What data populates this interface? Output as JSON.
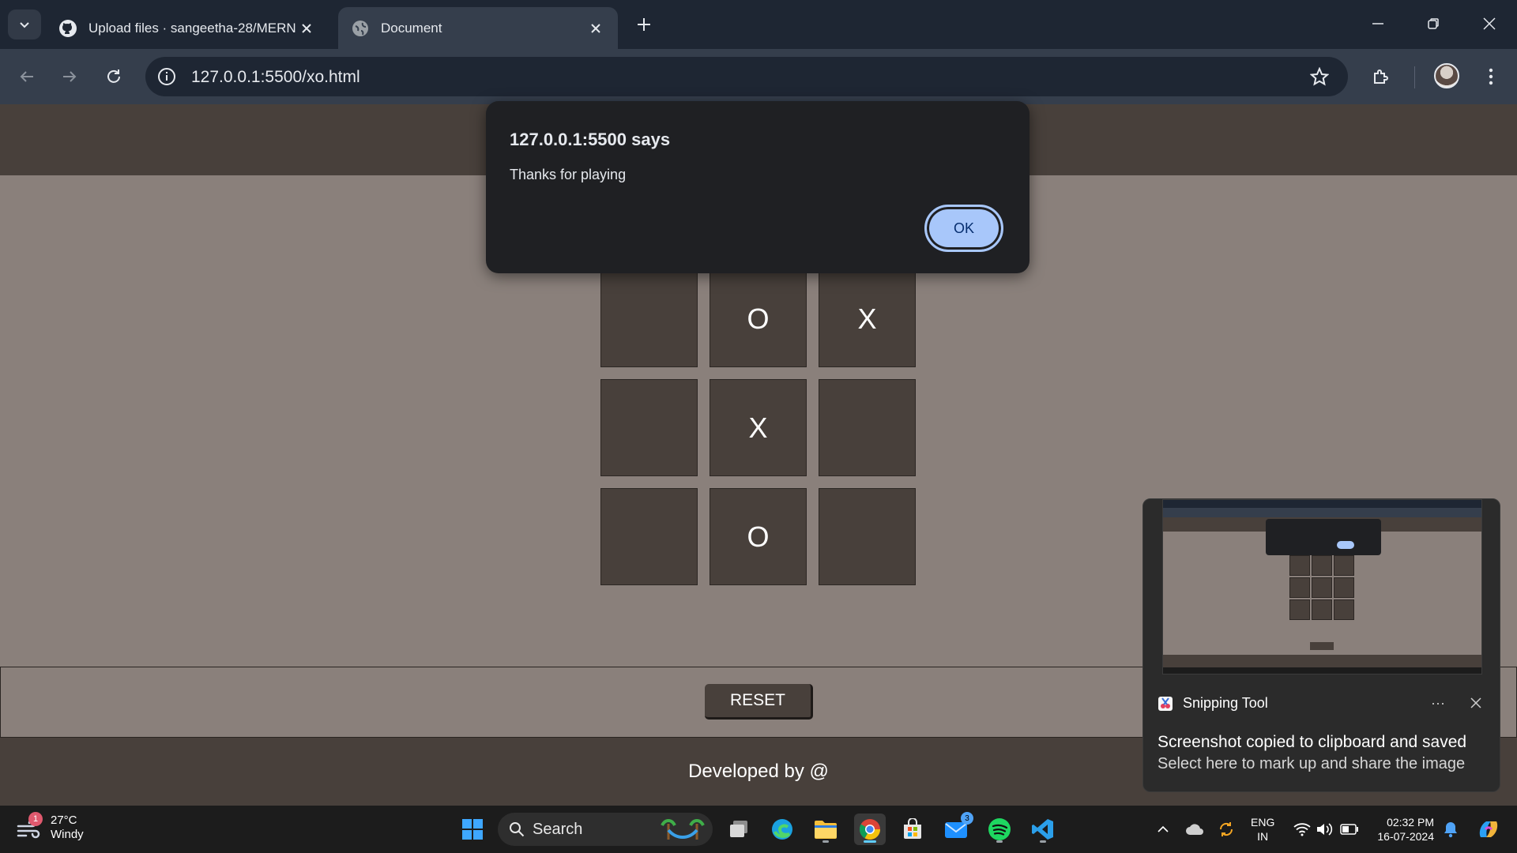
{
  "browser": {
    "tabs": [
      {
        "title": "Upload files · sangeetha-28/MERN",
        "favicon": "github-icon",
        "active": false
      },
      {
        "title": "Document",
        "favicon": "globe-icon",
        "active": true
      }
    ],
    "url": "127.0.0.1:5500/xo.html"
  },
  "game": {
    "board": [
      "",
      "O",
      "X",
      "",
      "X",
      "",
      "",
      "O",
      ""
    ],
    "reset_label": "RESET",
    "footer_text": "Developed by @"
  },
  "alert": {
    "origin": "127.0.0.1:5500 says",
    "message": "Thanks for playing",
    "ok_label": "OK"
  },
  "toast": {
    "app_name": "Snipping Tool",
    "more_label": "···",
    "line1": "Screenshot copied to clipboard and saved",
    "line2": "Select here to mark up and share the image"
  },
  "taskbar": {
    "weather_temp": "27°C",
    "weather_desc": "Windy",
    "weather_badge": "1",
    "search_label": "Search",
    "mail_badge": "3",
    "lang_line1": "ENG",
    "lang_line2": "IN",
    "time": "02:32 PM",
    "date": "16-07-2024"
  },
  "colors": {
    "accent_blue": "#a8c7fa",
    "page_bg": "#8a807b",
    "cell_bg": "#48403b",
    "chrome_dark": "#1e2633",
    "chrome_toolbar": "#353e4c"
  }
}
